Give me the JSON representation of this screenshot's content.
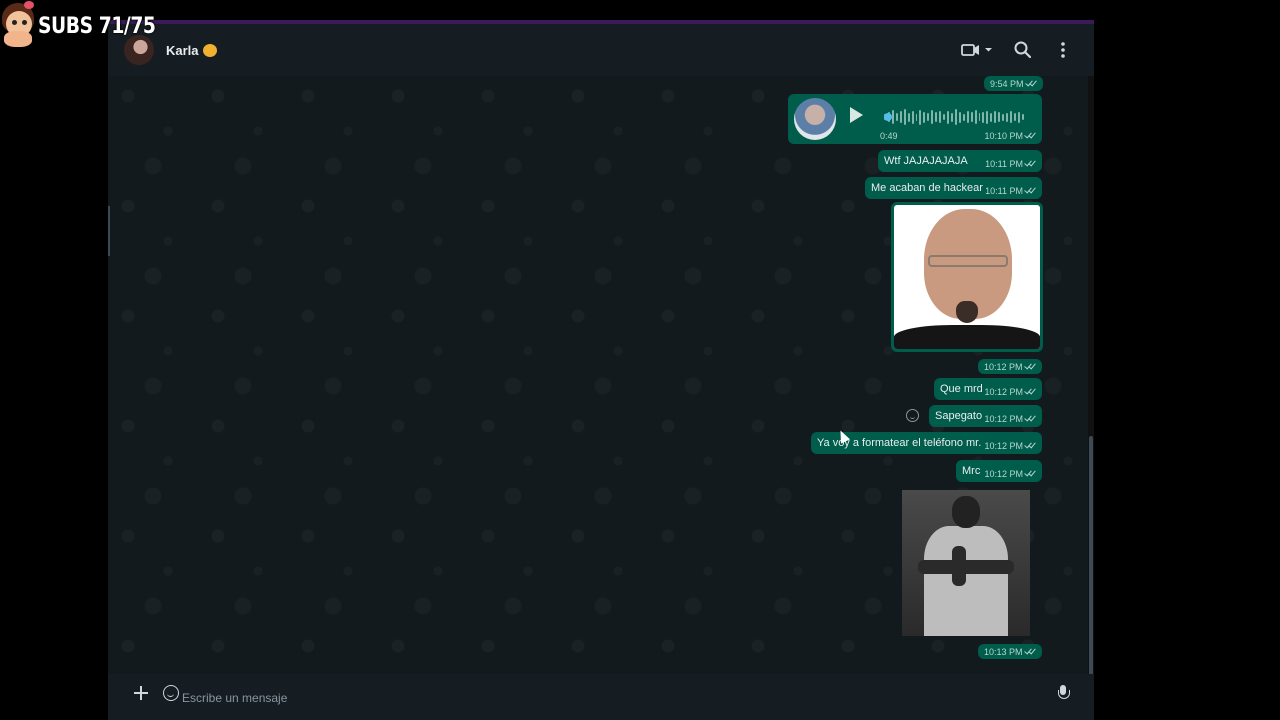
{
  "overlay": {
    "subs_counter": "SUBS 71/75"
  },
  "header": {
    "contact_name": "Karla",
    "contact_emoji_icon": "cat-face-icon"
  },
  "messages": [
    {
      "type": "time",
      "time": "9:54 PM"
    },
    {
      "type": "voice",
      "duration": "0:49",
      "time": "10:10 PM"
    },
    {
      "type": "text",
      "text": "Wtf JAJAJAJAJA",
      "time": "10:11 PM"
    },
    {
      "type": "text",
      "text": "Me acaban de hackear",
      "time": "10:11 PM"
    },
    {
      "type": "image",
      "time": "10:12 PM"
    },
    {
      "type": "text",
      "text": "Que mrd",
      "time": "10:12 PM"
    },
    {
      "type": "text",
      "text": "Sapegato",
      "time": "10:12 PM"
    },
    {
      "type": "text",
      "text": "Ya voy a formatear el teléfono mr.",
      "time": "10:12 PM"
    },
    {
      "type": "text",
      "text": "Mrc",
      "time": "10:12 PM"
    },
    {
      "type": "image",
      "time": "10:13 PM"
    }
  ],
  "composer": {
    "placeholder": "Escribe un mensaje"
  },
  "colors": {
    "outgoing_bubble": "#005c4b",
    "header_bg": "#161d22",
    "chat_bg": "#121a1e",
    "accent_wave": "#53bdeb"
  }
}
